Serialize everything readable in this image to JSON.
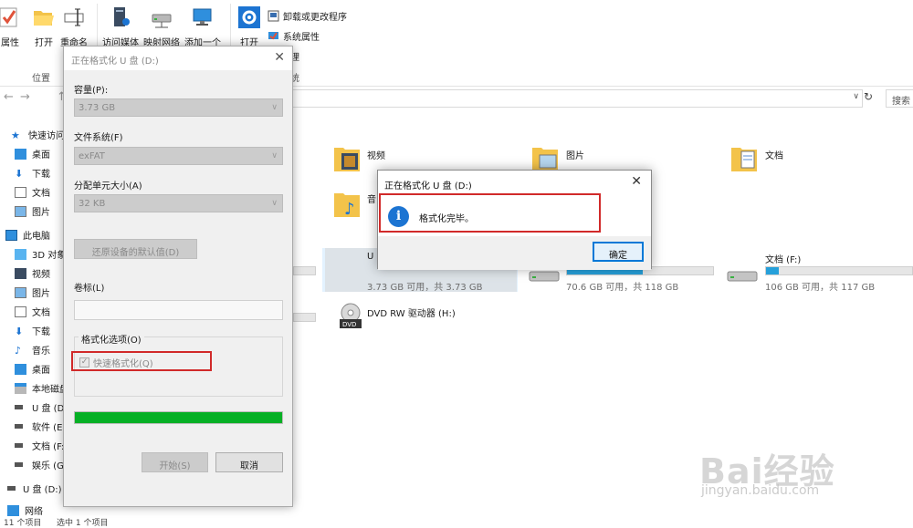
{
  "ribbon": {
    "properties_label": "属性",
    "open_label": "打开",
    "rename_label": "重命名",
    "access_media_label": "访问媒体",
    "map_drive_label": "映射网络",
    "add_location_label": "添加一个",
    "open2_label": "打开",
    "uninstall_label": "卸载或更改程序",
    "system_props_label": "系统属性",
    "manage_label": "理",
    "location_group": "位置",
    "system_group": "统"
  },
  "address_bar": {
    "search_placeholder": "搜索"
  },
  "nav_pane": {
    "items": [
      {
        "label": "快速访问"
      },
      {
        "label": "桌面"
      },
      {
        "label": "下载"
      },
      {
        "label": "文档"
      },
      {
        "label": "图片"
      },
      {
        "label": "此电脑"
      },
      {
        "label": "3D 对象"
      },
      {
        "label": "视频"
      },
      {
        "label": "图片"
      },
      {
        "label": "文档"
      },
      {
        "label": "下载"
      },
      {
        "label": "音乐"
      },
      {
        "label": "桌面"
      },
      {
        "label": "本地磁盘"
      },
      {
        "label": "U 盘 (D"
      },
      {
        "label": "软件 (E:"
      },
      {
        "label": "文档 (F:"
      },
      {
        "label": "娱乐 (G:"
      },
      {
        "label": "U 盘 (D:)"
      },
      {
        "label": "网络"
      }
    ],
    "status_left": "11 个项目",
    "status_right": "选中 1 个项目"
  },
  "content": {
    "folders": [
      {
        "name": "视频"
      },
      {
        "name": "图片"
      },
      {
        "name": "文档"
      },
      {
        "name": "音"
      }
    ],
    "drives": {
      "u_label": "U",
      "u_capacity": "3.73 GB 可用，共 3.73 GB",
      "mid_capacity": "70.6 GB 可用，共 118 GB",
      "mid_fill": 0.52,
      "f_label": "文档 (F:)",
      "f_capacity": "106 GB 可用，共 117 GB",
      "f_fill": 0.09,
      "dvd_label": "DVD RW 驱动器 (H:)"
    }
  },
  "format_dialog": {
    "title": "正在格式化 U 盘 (D:)",
    "capacity_label": "容量(P):",
    "capacity_value": "3.73 GB",
    "fs_label": "文件系统(F)",
    "fs_value": "exFAT",
    "alloc_label": "分配单元大小(A)",
    "alloc_value": "32 KB",
    "restore_button": "还原设备的默认值(D)",
    "volume_label": "卷标(L)",
    "volume_value": "",
    "options_label": "格式化选项(O)",
    "quick_format": "快速格式化(Q)",
    "quick_checked": true,
    "progress": 1.0,
    "start_button": "开始(S)",
    "cancel_button": "取消"
  },
  "message_box": {
    "title": "正在格式化 U 盘 (D:)",
    "text": "格式化完毕。",
    "ok_button": "确定"
  },
  "watermark": {
    "brand": "Bai经验",
    "url": "jingyan.baidu.com"
  },
  "colors": {
    "accent": "#0078d7",
    "progress_green": "#06b025",
    "highlight_red": "#d12a2a",
    "drive_bar": "#26a0da"
  }
}
